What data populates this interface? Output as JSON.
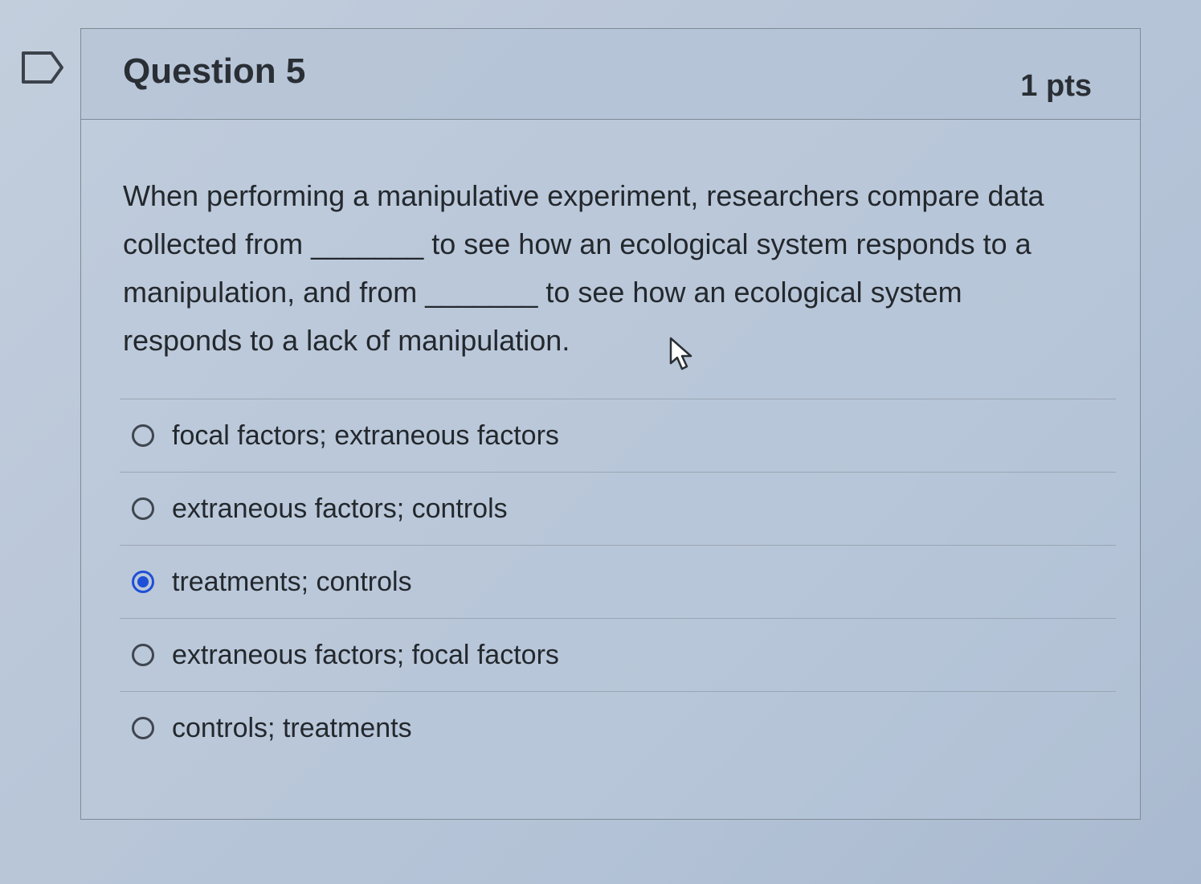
{
  "question": {
    "title": "Question 5",
    "points": "1 pts",
    "text": "When performing a manipulative experiment, researchers compare data collected from _______ to see how an ecological system responds to a manipulation, and from _______ to see how an ecological system responds to a lack of manipulation."
  },
  "answers": [
    {
      "label": "focal factors; extraneous factors",
      "selected": false
    },
    {
      "label": "extraneous factors; controls",
      "selected": false
    },
    {
      "label": "treatments; controls",
      "selected": true
    },
    {
      "label": "extraneous factors; focal factors",
      "selected": false
    },
    {
      "label": "controls; treatments",
      "selected": false
    }
  ],
  "colors": {
    "accent": "#1f4fd6",
    "text": "#23282d",
    "border": "#7f8a96"
  },
  "icons": {
    "flag": "flag-icon",
    "cursor": "mouse-cursor-icon"
  }
}
